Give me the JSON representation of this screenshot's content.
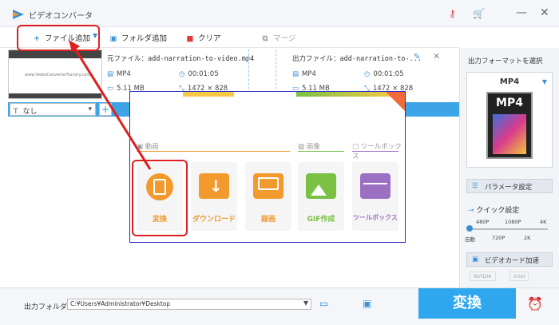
{
  "titlebar": {
    "title": "ビデオコンバータ",
    "icons": [
      "key-icon",
      "cart-icon"
    ],
    "window_buttons": [
      "minimize",
      "close"
    ]
  },
  "toolbar": {
    "add_file": "ファイル追加",
    "add_folder": "フォルダ追加",
    "clear": "クリア",
    "merge": "マージ"
  },
  "source": {
    "label": "元ファイル：",
    "filename": "add-narration-to-video.mp4",
    "format": "MP4",
    "duration": "00:01:05",
    "size": "5.11 MB",
    "resolution": "1472 × 828"
  },
  "output": {
    "label": "出力ファイル：",
    "filename": "add-narration-to-...",
    "format": "MP4",
    "duration": "00:01:05",
    "size": "5.11 MB",
    "resolution": "1472 × 828"
  },
  "thumbnail": {
    "caption": "www.VideoConverterFactory.com"
  },
  "subtitle": {
    "value": "なし"
  },
  "popup": {
    "video_section": "動画",
    "image_section": "画像",
    "toolbox_section": "ツールボックス",
    "tiles": [
      {
        "label": "変換",
        "color": "#f29a2e"
      },
      {
        "label": "ダウンロード",
        "color": "#f29a2e"
      },
      {
        "label": "録画",
        "color": "#f29a2e"
      },
      {
        "label": "GIF作成",
        "color": "#7ac143"
      },
      {
        "label": "ツールボックス",
        "color": "#9b6fc2"
      }
    ]
  },
  "right_panel": {
    "title": "出力フォーマットを選択",
    "format": "MP4",
    "card_text": "MP4",
    "param_button": "パラメータ設定",
    "quick_label": "クイック設定",
    "ticks_top": [
      "480P",
      "1080P",
      "4K"
    ],
    "ticks_bottom": [
      "自動",
      "720P",
      "2K"
    ],
    "gpu_button": "ビデオカード加速",
    "vendors": [
      "NVIDIA",
      "Intel"
    ]
  },
  "footer": {
    "out_folder_label": "出力フォルダ：",
    "out_path": "C:¥Users¥Administrator¥Desktop",
    "convert": "変換"
  }
}
